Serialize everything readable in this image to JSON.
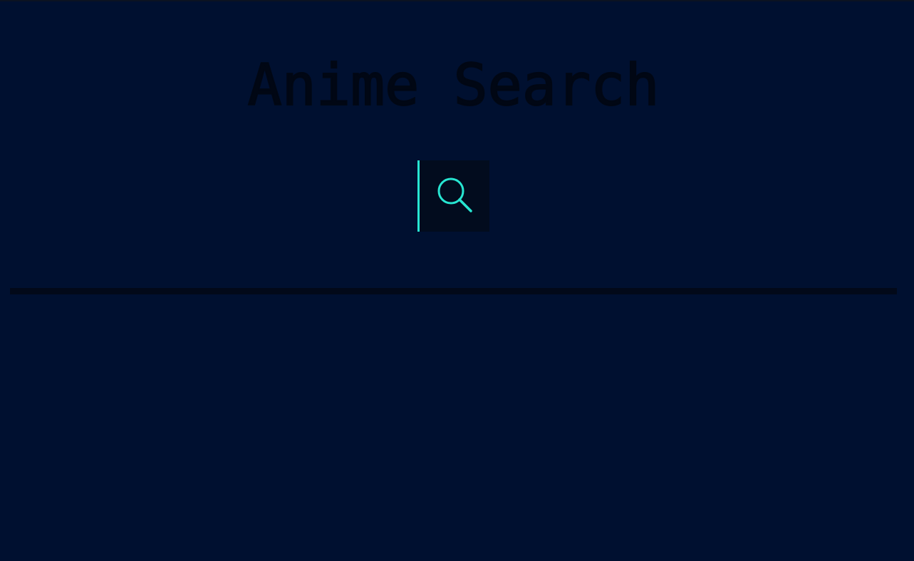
{
  "page": {
    "title": "Anime Search"
  },
  "search": {
    "button_icon": "search-icon",
    "input_value": "",
    "input_placeholder": ""
  },
  "colors": {
    "background": "#001030",
    "title_text": "#010714",
    "accent": "#27e6d2",
    "search_button_bg": "#020c1e",
    "divider": "#020919"
  }
}
